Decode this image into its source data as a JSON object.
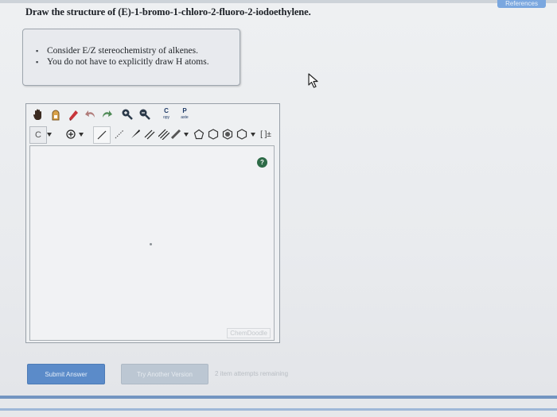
{
  "header": {
    "references_label": "References",
    "question": "Draw the structure of (E)-1-bromo-1-chloro-2-fluoro-2-iodoethylene."
  },
  "hints": [
    "Consider E/Z stereochemistry of alkenes.",
    "You do not have to explicitly draw H atoms."
  ],
  "toolbar": {
    "copy_label_top": "C",
    "copy_label_bottom": "opy",
    "paste_label_top": "P",
    "paste_label_bottom": "aste",
    "element_label": "C",
    "bracket_label": "[ ]±"
  },
  "editor": {
    "help_label": "?",
    "brand_label": "ChemDoodle"
  },
  "actions": {
    "submit_label": "Submit Answer",
    "try_label": "Try Another Version",
    "attempts_text": "2 item attempts remaining"
  },
  "colors": {
    "submit": "#5b8bc9",
    "try_another": "#bcc7d3",
    "help": "#2e6b47"
  }
}
